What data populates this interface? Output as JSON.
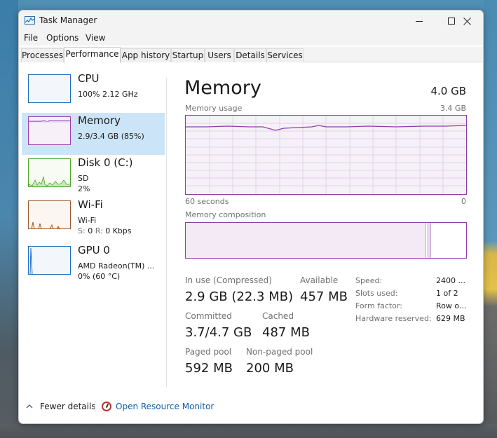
{
  "window": {
    "title": "Task Manager",
    "minimize_icon": "minimize-icon",
    "maximize_icon": "maximize-icon",
    "close_icon": "close-icon"
  },
  "menu": {
    "items": [
      "File",
      "Options",
      "View"
    ]
  },
  "tabs": {
    "items": [
      "Processes",
      "Performance",
      "App history",
      "Startup",
      "Users",
      "Details",
      "Services"
    ],
    "active": "Performance"
  },
  "sidebar": {
    "cpu": {
      "title": "CPU",
      "line1": "100%  2.12 GHz"
    },
    "memory": {
      "title": "Memory",
      "line1": "2.9/3.4 GB (85%)"
    },
    "disk": {
      "title": "Disk 0 (C:)",
      "line1": "SD",
      "line2": "2%"
    },
    "wifi": {
      "title": "Wi-Fi",
      "line1": "Wi-Fi",
      "line2_s_label": "S:",
      "line2_s": "0",
      "line2_r_label": "R:",
      "line2_r": "0 Kbps"
    },
    "gpu": {
      "title": "GPU 0",
      "line1": "AMD Radeon(TM) ...",
      "line2": "0%  (60 °C)"
    }
  },
  "main": {
    "title": "Memory",
    "total": "4.0 GB",
    "usage_label": "Memory usage",
    "usage_max": "3.4 GB",
    "time_left": "60 seconds",
    "time_right": "0",
    "composition_label": "Memory composition",
    "usage_level_percent": 85
  },
  "stats": {
    "in_use_label": "In use (Compressed)",
    "in_use_value": "2.9 GB (22.3 MB)",
    "available_label": "Available",
    "available_value": "457 MB",
    "committed_label": "Committed",
    "committed_value": "3.7/4.7 GB",
    "cached_label": "Cached",
    "cached_value": "487 MB",
    "paged_label": "Paged pool",
    "paged_value": "592 MB",
    "nonpaged_label": "Non-paged pool",
    "nonpaged_value": "200 MB"
  },
  "details": {
    "speed_label": "Speed:",
    "speed_value": "2400 ...",
    "slots_label": "Slots used:",
    "slots_value": "1 of 2",
    "form_label": "Form factor:",
    "form_value": "Row o...",
    "hw_label": "Hardware reserved:",
    "hw_value": "629 MB"
  },
  "footer": {
    "fewer_details": "Fewer details",
    "open_resource_monitor": "Open Resource Monitor"
  },
  "colors": {
    "memory_accent": "#8b3fa8",
    "cpu_accent": "#1b6fc1",
    "disk_accent": "#4ea626",
    "wifi_accent": "#a0572a",
    "selection": "#cce4f7",
    "link": "#0f5fa8"
  }
}
